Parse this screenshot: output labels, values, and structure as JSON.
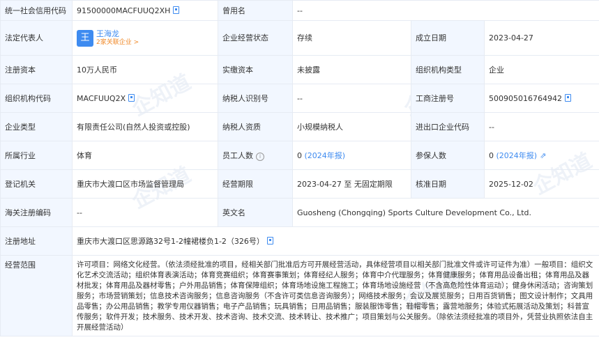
{
  "watermark": "企知道",
  "credit_code": {
    "label": "统一社会信用代码",
    "value": "91500000MACFUUQ2XH"
  },
  "former_name": {
    "label": "曾用名",
    "value": "--"
  },
  "legal_rep": {
    "label": "法定代表人",
    "avatar_char": "王",
    "name": "王海龙",
    "related": "2家关联企业 >"
  },
  "status": {
    "label": "企业经营状态",
    "value": "存续"
  },
  "established": {
    "label": "成立日期",
    "value": "2023-04-27"
  },
  "reg_capital": {
    "label": "注册资本",
    "value": "10万人民币"
  },
  "paid_capital": {
    "label": "实缴资本",
    "value": "未披露"
  },
  "org_type": {
    "label": "组织机构类型",
    "value": "企业"
  },
  "org_code": {
    "label": "组织机构代码",
    "value": "MACFUUQ2X"
  },
  "taxpayer_id": {
    "label": "纳税人识别号",
    "value": "--"
  },
  "biz_reg_no": {
    "label": "工商注册号",
    "value": "500905016764942"
  },
  "company_type": {
    "label": "企业类型",
    "value": "有限责任公司(自然人投资或控股)"
  },
  "taxpayer_qual": {
    "label": "纳税人资质",
    "value": "小规模纳税人"
  },
  "import_export": {
    "label": "进出口企业代码",
    "value": "--"
  },
  "industry": {
    "label": "所属行业",
    "value": "体育"
  },
  "employees": {
    "label": "员工人数",
    "value": "0",
    "note": "(2024年报)"
  },
  "insured": {
    "label": "参保人数",
    "value": "0",
    "note": "(2024年报)"
  },
  "reg_authority": {
    "label": "登记机关",
    "value": "重庆市大渡口区市场监督管理局"
  },
  "term": {
    "label": "经营期限",
    "value": "2023-04-27 至 无固定期限"
  },
  "approval_date": {
    "label": "核准日期",
    "value": "2025-12-02"
  },
  "customs_code": {
    "label": "海关注册编码",
    "value": "--"
  },
  "english_name": {
    "label": "英文名",
    "value": "Guosheng (Chongqing) Sports Culture Development Co., Ltd."
  },
  "address": {
    "label": "注册地址",
    "value": "重庆市大渡口区思源路32号1-2幢裙楼负1-2（326号）"
  },
  "scope": {
    "label": "经营范围",
    "value": "许可项目：网络文化经营。（依法须经批准的项目，经相关部门批准后方可开展经营活动，具体经营项目以相关部门批准文件或许可证件为准）一般项目：组织文化艺术交流活动；组织体育表演活动；体育竞赛组织；体育赛事策划；体育经纪人服务；体育中介代理服务；体育健康服务；体育用品设备出租；体育用品及器材批发；体育用品及器材零售；户外用品销售；体育保障组织；体育场地设施工程施工；体育场地设施经营（不含高危险性体育运动）；健身休闲活动；咨询策划服务；市场营销策划；信息技术咨询服务；信息咨询服务（不含许可类信息咨询服务）；网络技术服务；会议及展览服务；日用百货销售；图文设计制作；文具用品零售；办公用品销售；教学专用仪器销售；电子产品销售；玩具销售；日用品销售；服装服饰零售；鞋帽零售；露营地服务；体验式拓展活动及策划；科普宣传服务；软件开发；技术服务、技术开发、技术咨询、技术交流、技术转让、技术推广；项目策划与公关服务。（除依法须经批准的项目外，凭营业执照依法自主开展经营活动）"
  }
}
